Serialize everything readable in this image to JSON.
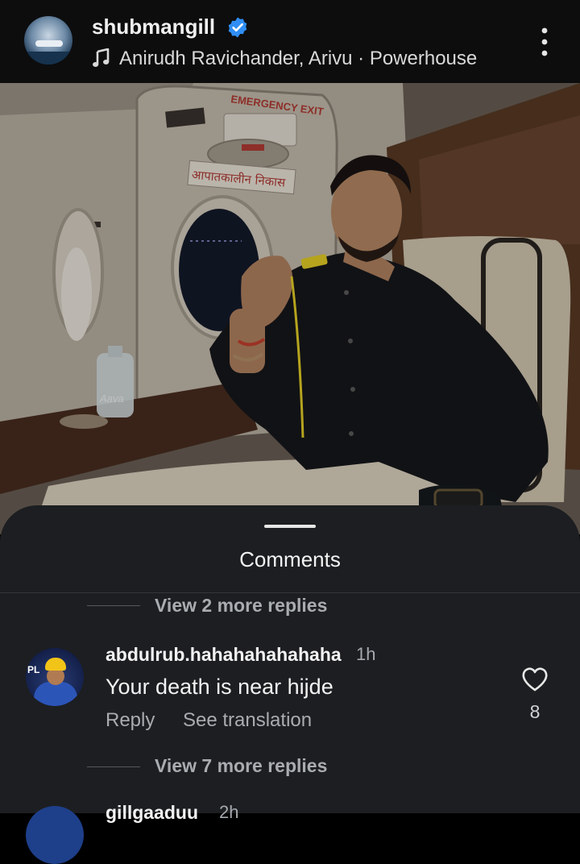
{
  "post": {
    "username": "shubmangill",
    "audio": "Anirudh Ravichander, Arivu · Powerhouse"
  },
  "photo": {
    "sign_emergency": "EMERGENCY EXIT",
    "sign_hindi": "आपातकालीन निकास",
    "bottle_label": "Aava"
  },
  "comments": {
    "title": "Comments",
    "view_replies_top": "View 2 more replies",
    "items": [
      {
        "username": "abdulrub.hahahahahahaha",
        "time": "1h",
        "text": "Your death is near hijde",
        "reply_label": "Reply",
        "translate_label": "See translation",
        "likes": "8",
        "view_replies": "View 7 more replies"
      }
    ],
    "next": {
      "username": "gillgaaduu",
      "time": "2h"
    }
  },
  "colors": {
    "sheet_bg": "#1c1e21",
    "verified_blue": "#2f8ef4",
    "muted_text": "#a9acb0"
  },
  "icons": [
    "verified-badge-icon",
    "music-note-icon",
    "more-options-icon",
    "heart-icon"
  ]
}
